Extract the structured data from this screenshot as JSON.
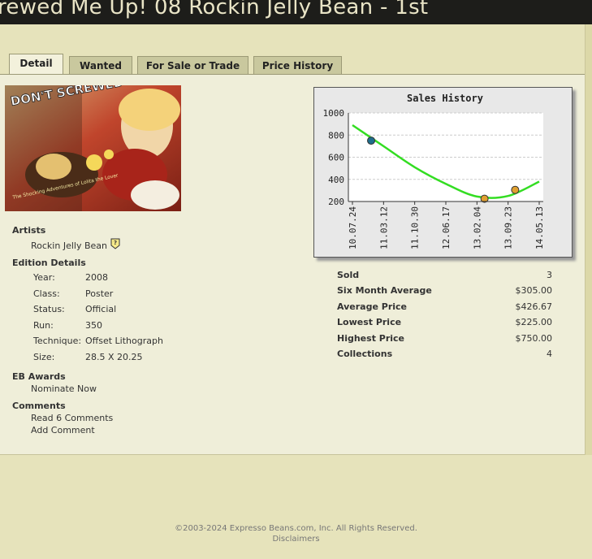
{
  "page": {
    "title": "rewed Me Up! 08 Rockin Jelly Bean - 1st"
  },
  "tabs": [
    {
      "label": "Detail",
      "active": true
    },
    {
      "label": "Wanted",
      "active": false
    },
    {
      "label": "For Sale or Trade",
      "active": false
    },
    {
      "label": "Price History",
      "active": false
    }
  ],
  "poster": {
    "headline": "DON'T SCREWED ME UP!!!",
    "subtext": "The Shocking Adventures of Lolita the Lover"
  },
  "artists": {
    "heading": "Artists",
    "name": "Rockin Jelly Bean"
  },
  "edition": {
    "heading": "Edition Details",
    "rows": [
      {
        "label": "Year:",
        "value": "2008"
      },
      {
        "label": "Class:",
        "value": "Poster"
      },
      {
        "label": "Status:",
        "value": "Official"
      },
      {
        "label": "Run:",
        "value": "350"
      },
      {
        "label": "Technique:",
        "value": "Offset Lithograph"
      },
      {
        "label": "Size:",
        "value": "28.5 X 20.25"
      }
    ]
  },
  "awards": {
    "heading": "EB Awards",
    "link": "Nominate Now"
  },
  "comments": {
    "heading": "Comments",
    "read": "Read 6 Comments",
    "add": "Add Comment"
  },
  "chart_data": {
    "type": "line",
    "title": "Sales History",
    "xlabel": "",
    "ylabel": "",
    "x_ticks": [
      "10.07.24",
      "11.03.12",
      "11.10.30",
      "12.06.17",
      "13.02.04",
      "13.09.23",
      "14.05.13"
    ],
    "y_ticks": [
      200,
      400,
      600,
      800,
      1000
    ],
    "ylim": [
      200,
      1000
    ],
    "grid": true,
    "trend_color": "#33dd22",
    "trend": [
      {
        "x": "10.07.24",
        "y": 890
      },
      {
        "x": "11.03.12",
        "y": 700
      },
      {
        "x": "11.10.30",
        "y": 510
      },
      {
        "x": "12.06.17",
        "y": 360
      },
      {
        "x": "13.02.04",
        "y": 245
      },
      {
        "x": "13.09.23",
        "y": 250
      },
      {
        "x": "14.05.13",
        "y": 380
      }
    ],
    "points": [
      {
        "x": "10.12.10",
        "y": 750,
        "color": "#1f6e8c"
      },
      {
        "x": "13.04.01",
        "y": 225,
        "color": "#e0a030"
      },
      {
        "x": "13.11.15",
        "y": 305,
        "color": "#e0a030"
      }
    ]
  },
  "stats": [
    {
      "label": "Sold",
      "value": "3"
    },
    {
      "label": "Six Month Average",
      "value": "$305.00"
    },
    {
      "label": "Average Price",
      "value": "$426.67"
    },
    {
      "label": "Lowest Price",
      "value": "$225.00"
    },
    {
      "label": "Highest Price",
      "value": "$750.00"
    },
    {
      "label": "Collections",
      "value": "4"
    }
  ],
  "footer": {
    "copyright": "©2003-2024 Expresso Beans.com, Inc. All Rights Reserved.",
    "disclaimers": "Disclaimers"
  }
}
